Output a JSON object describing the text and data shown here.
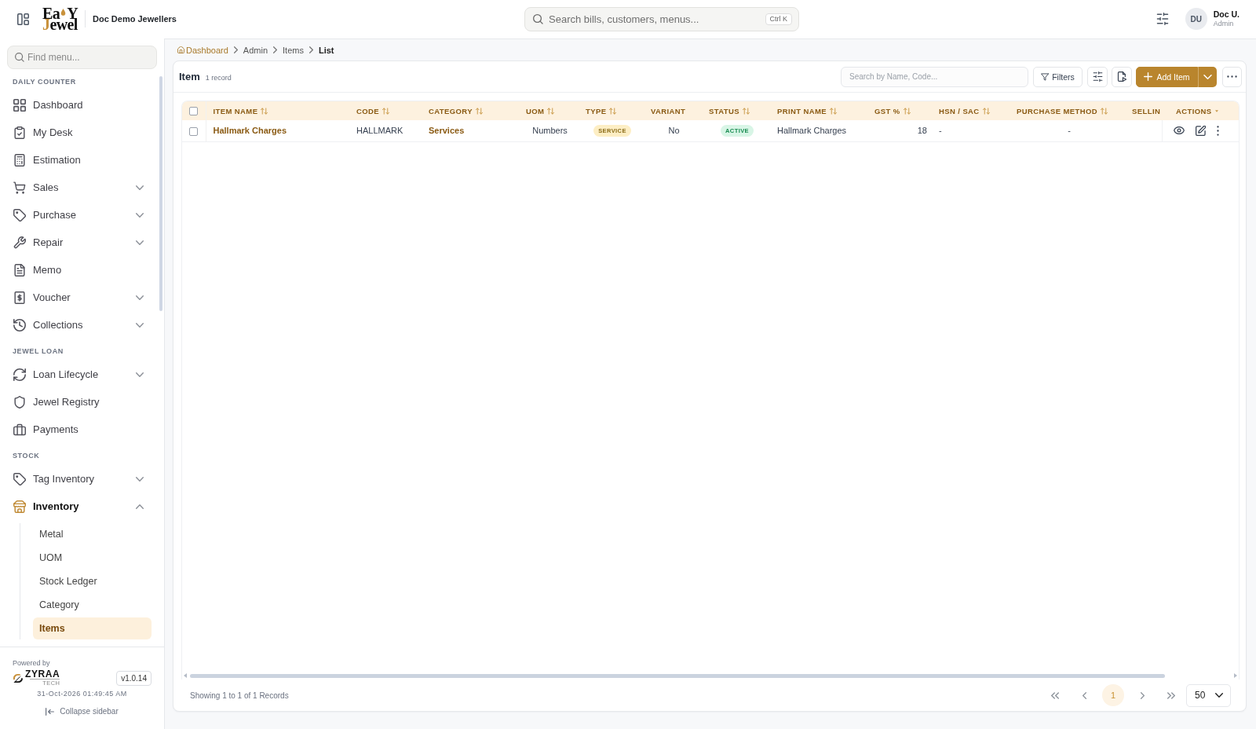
{
  "topbar": {
    "logo": {
      "line_1": [
        "Ea",
        "Y"
      ],
      "line_2": [
        "J",
        "ewel"
      ]
    },
    "company": "Doc Demo Jewellers",
    "search": {
      "placeholder": "Search bills, customers, menus...",
      "shortcut": "Ctrl K"
    },
    "user": {
      "initials": "DU",
      "name": "Doc U.",
      "role": "Admin"
    }
  },
  "sidebar": {
    "search": {
      "placeholder": "Find menu..."
    },
    "sections": [
      {
        "title": "DAILY COUNTER",
        "items": [
          {
            "label": "Dashboard",
            "selected": false
          },
          {
            "label": "My Desk",
            "selected": false
          },
          {
            "label": "Estimation",
            "selected": false
          },
          {
            "label": "Sales",
            "selected": false,
            "expanded": false
          },
          {
            "label": "Purchase",
            "selected": false,
            "expanded": false
          },
          {
            "label": "Repair",
            "selected": false,
            "expanded": false
          },
          {
            "label": "Memo",
            "selected": false
          },
          {
            "label": "Voucher",
            "selected": false,
            "expanded": false
          },
          {
            "label": "Collections",
            "selected": false,
            "expanded": false
          }
        ]
      },
      {
        "title": "JEWEL LOAN",
        "items": [
          {
            "label": "Loan Lifecycle",
            "selected": false,
            "expanded": false
          },
          {
            "label": "Jewel Registry",
            "selected": false
          },
          {
            "label": "Payments",
            "selected": false
          }
        ]
      },
      {
        "title": "STOCK",
        "items": [
          {
            "label": "Tag Inventory",
            "selected": false,
            "expanded": false
          },
          {
            "label": "Inventory",
            "selected": true,
            "expanded": true,
            "children": [
              {
                "label": "Metal",
                "selected": false
              },
              {
                "label": "UOM",
                "selected": false
              },
              {
                "label": "Stock Ledger",
                "selected": false
              },
              {
                "label": "Category",
                "selected": false
              },
              {
                "label": "Items",
                "selected": true
              }
            ]
          }
        ]
      }
    ],
    "footer": {
      "powered_by": "Powered by",
      "brand": {
        "name": "ZYRAA",
        "tagline": "TECH"
      },
      "version": "v1.0.14",
      "datetime": "31-Oct-2026 01:49:45 AM",
      "collapse": "Collapse sidebar"
    }
  },
  "breadcrumb": [
    {
      "label": "Dashboard",
      "current": false
    },
    {
      "label": "Admin",
      "current": false
    },
    {
      "label": "Items",
      "current": false
    },
    {
      "label": "List",
      "current": true
    }
  ],
  "list_view": {
    "title": "Item",
    "record_count": "1 record",
    "toolbar": {
      "search": {
        "placeholder": "Search by Name, Code..."
      },
      "filters_button": "Filters",
      "add_button": "Add Item"
    },
    "table": {
      "select_all": {
        "checked": false
      },
      "columns": [
        {
          "label": "ITEM NAME",
          "kind": "data",
          "sortable": true
        },
        {
          "label": "CODE",
          "kind": "data",
          "sortable": true
        },
        {
          "label": "CATEGORY",
          "kind": "data",
          "sortable": true
        },
        {
          "label": "UOM",
          "kind": "data",
          "sortable": true
        },
        {
          "label": "TYPE",
          "kind": "data",
          "sortable": true
        },
        {
          "label": "VARIANT",
          "kind": "data",
          "sortable": false
        },
        {
          "label": "STATUS",
          "kind": "data",
          "sortable": true
        },
        {
          "label": "PRINT NAME",
          "kind": "data",
          "sortable": true
        },
        {
          "label": "GST %",
          "kind": "data",
          "sortable": true
        },
        {
          "label": "HSN / SAC",
          "kind": "data",
          "sortable": true
        },
        {
          "label": "PURCHASE METHOD",
          "kind": "data",
          "sortable": true
        },
        {
          "label": "SELLIN",
          "kind": "data"
        },
        {
          "label": "ACTIONS",
          "kind": "actions"
        }
      ],
      "rows": [
        {
          "checked": false,
          "cells": [
            {
              "kind": "link",
              "text": "Hallmark Charges"
            },
            {
              "kind": "text",
              "text": "HALLMARK"
            },
            {
              "kind": "link",
              "text": "Services"
            },
            {
              "kind": "text",
              "text": "Numbers"
            },
            {
              "kind": "badge",
              "text": "SERVICE",
              "color": "#fdeec4"
            },
            {
              "kind": "text",
              "text": "No"
            },
            {
              "kind": "badge",
              "text": "ACTIVE",
              "color": "#d8f5e6"
            },
            {
              "kind": "text",
              "text": "Hallmark Charges"
            },
            {
              "kind": "text",
              "text": "18"
            },
            {
              "kind": "text",
              "text": "-"
            },
            {
              "kind": "text",
              "text": "-"
            }
          ]
        }
      ]
    },
    "footer": {
      "summary": "Showing 1 to 1 of 1 Records",
      "pagination": {
        "pages": [
          {
            "label": "1",
            "selected": true
          }
        ],
        "page_size": "50"
      }
    }
  }
}
